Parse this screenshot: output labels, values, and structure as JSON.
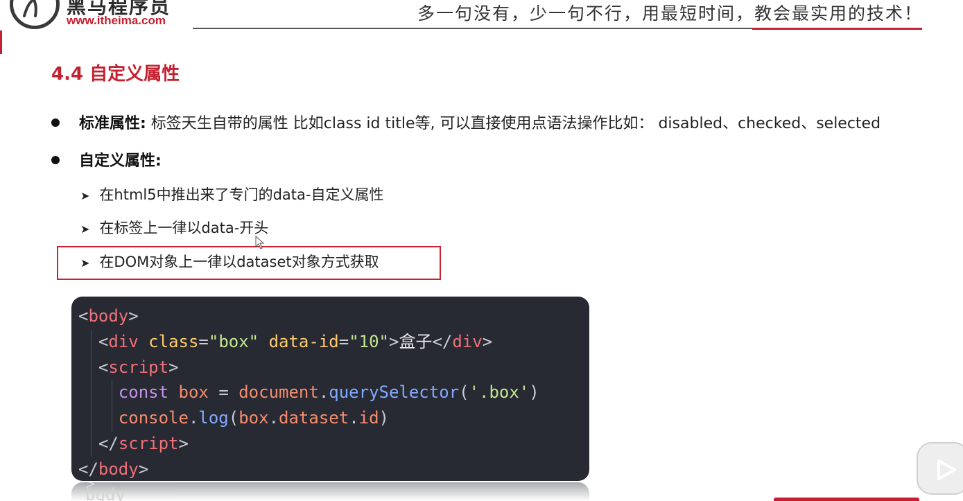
{
  "header": {
    "brand_name": "黑马程序员",
    "brand_url": "www.itheima.com",
    "slogan": "多一句没有，少一句不行，用最短时间，教会最实用的技术！"
  },
  "section": {
    "title": "4.4 自定义属性"
  },
  "bullets": [
    {
      "label": "标准属性:",
      "text": " 标签天生自带的属性 比如class id title等, 可以直接使用点语法操作比如： disabled、checked、selected"
    },
    {
      "label": "自定义属性:",
      "text": ""
    }
  ],
  "sub_items": [
    "在html5中推出来了专门的data-自定义属性",
    "在标签上一律以data-开头",
    "在DOM对象上一律以dataset对象方式获取"
  ],
  "code": {
    "l1_open": "<",
    "l1_tag": "body",
    "l1_close": ">",
    "l2_open": "<",
    "l2_tag": "div",
    "l2_attr1": "class",
    "l2_eq1": "=",
    "l2_val1": "\"box\"",
    "l2_attr2": "data-id",
    "l2_eq2": "=",
    "l2_val2": "\"10\"",
    "l2_gt": ">",
    "l2_text": "盒子",
    "l2_end_open": "</",
    "l2_end_tag": "div",
    "l2_end_close": ">",
    "l3_open": "<",
    "l3_tag": "script",
    "l3_close": ">",
    "l4_kw": "const",
    "l4_var": "box",
    "l4_eq": "=",
    "l4_obj": "document",
    "l4_dot": ".",
    "l4_fn": "querySelector",
    "l4_paren_open": "(",
    "l4_str": "'.box'",
    "l4_paren_close": ")",
    "l5_obj": "console",
    "l5_dot": ".",
    "l5_fn": "log",
    "l5_paren_open": "(",
    "l5_var": "box",
    "l5_dot2": ".",
    "l5_prop": "dataset",
    "l5_dot3": ".",
    "l5_prop2": "id",
    "l5_paren_close": ")",
    "l6_open": "</",
    "l6_tag": "script",
    "l6_close": ">",
    "l7_open": "</",
    "l7_tag": "body",
    "l7_close": ">"
  },
  "colors": {
    "accent_red": "#c4202f",
    "code_bg": "#282a33",
    "highlight_border": "#d3202f"
  },
  "icons": {
    "logo": "horse-logo-icon",
    "play": "play-icon",
    "cursor": "mouse-cursor-icon"
  }
}
